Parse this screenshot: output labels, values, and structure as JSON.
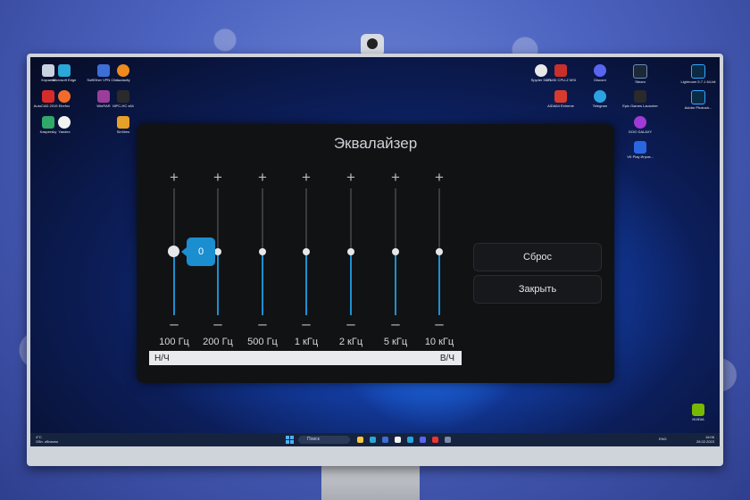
{
  "equalizer": {
    "title": "Эквалайзер",
    "plus_symbol": "+",
    "minus_symbol": "–",
    "bands": [
      {
        "label": "100 Гц",
        "value": 0
      },
      {
        "label": "200 Гц",
        "value": 0
      },
      {
        "label": "500 Гц",
        "value": 0
      },
      {
        "label": "1 кГц",
        "value": 0
      },
      {
        "label": "2 кГц",
        "value": 0
      },
      {
        "label": "5 кГц",
        "value": 0
      },
      {
        "label": "10 кГц",
        "value": 0
      }
    ],
    "tooltip_value": "0",
    "range_low": "Н/Ч",
    "range_high": "В/Ч",
    "reset_label": "Сброс",
    "close_label": "Закрыть",
    "accent_color": "#1b8ed0"
  },
  "desktop": {
    "icons_left": [
      {
        "label": "Корзина",
        "icon": "recycle-bin-icon"
      },
      {
        "label": "Microsoft Edge",
        "icon": "edge-icon"
      },
      {
        "label": "SoftEther VPN Clie...",
        "icon": "vpn-icon"
      },
      {
        "label": "Audacity",
        "icon": "audacity-icon"
      },
      {
        "label": "AutoCAD 2019 -...",
        "icon": "autocad-icon"
      },
      {
        "label": "Firefox",
        "icon": "firefox-icon"
      },
      {
        "label": "WinRAR",
        "icon": "winrar-icon"
      },
      {
        "label": "MPC-HC x64",
        "icon": "mpc-icon"
      },
      {
        "label": "Kaspersky",
        "icon": "kaspersky-icon"
      },
      {
        "label": "Yandex",
        "icon": "yandex-icon"
      },
      {
        "label": "SinView",
        "icon": "sinview-icon"
      }
    ],
    "icons_right": [
      {
        "label": "Spyder 5.0.1",
        "icon": "spyder-icon"
      },
      {
        "label": "CPUID CPU-Z MSI",
        "icon": "cpuz-icon"
      },
      {
        "label": "Discord",
        "icon": "discord-icon"
      },
      {
        "label": "Steam",
        "icon": "steam-icon"
      },
      {
        "label": "Lightroom 5.7.1 64-bit",
        "icon": "lightroom-icon"
      },
      {
        "label": "AIDA64 Extreme",
        "icon": "aida-icon"
      },
      {
        "label": "Telegram",
        "icon": "telegram-icon"
      },
      {
        "label": "Epic Games Launcher",
        "icon": "epic-icon"
      },
      {
        "label": "Adobe Photosh...",
        "icon": "photoshop-icon"
      },
      {
        "label": "GOG GALAXY",
        "icon": "gog-icon"
      },
      {
        "label": "VK Play Игров...",
        "icon": "vkplay-icon"
      },
      {
        "label": "NVIDIA",
        "icon": "nvidia-icon"
      }
    ]
  },
  "taskbar": {
    "weather_temp": "4°C",
    "weather_desc": "Обл. облачно",
    "search_placeholder": "Поиск",
    "lang": "ENG",
    "time": "16:06",
    "date": "28.02.2023"
  }
}
